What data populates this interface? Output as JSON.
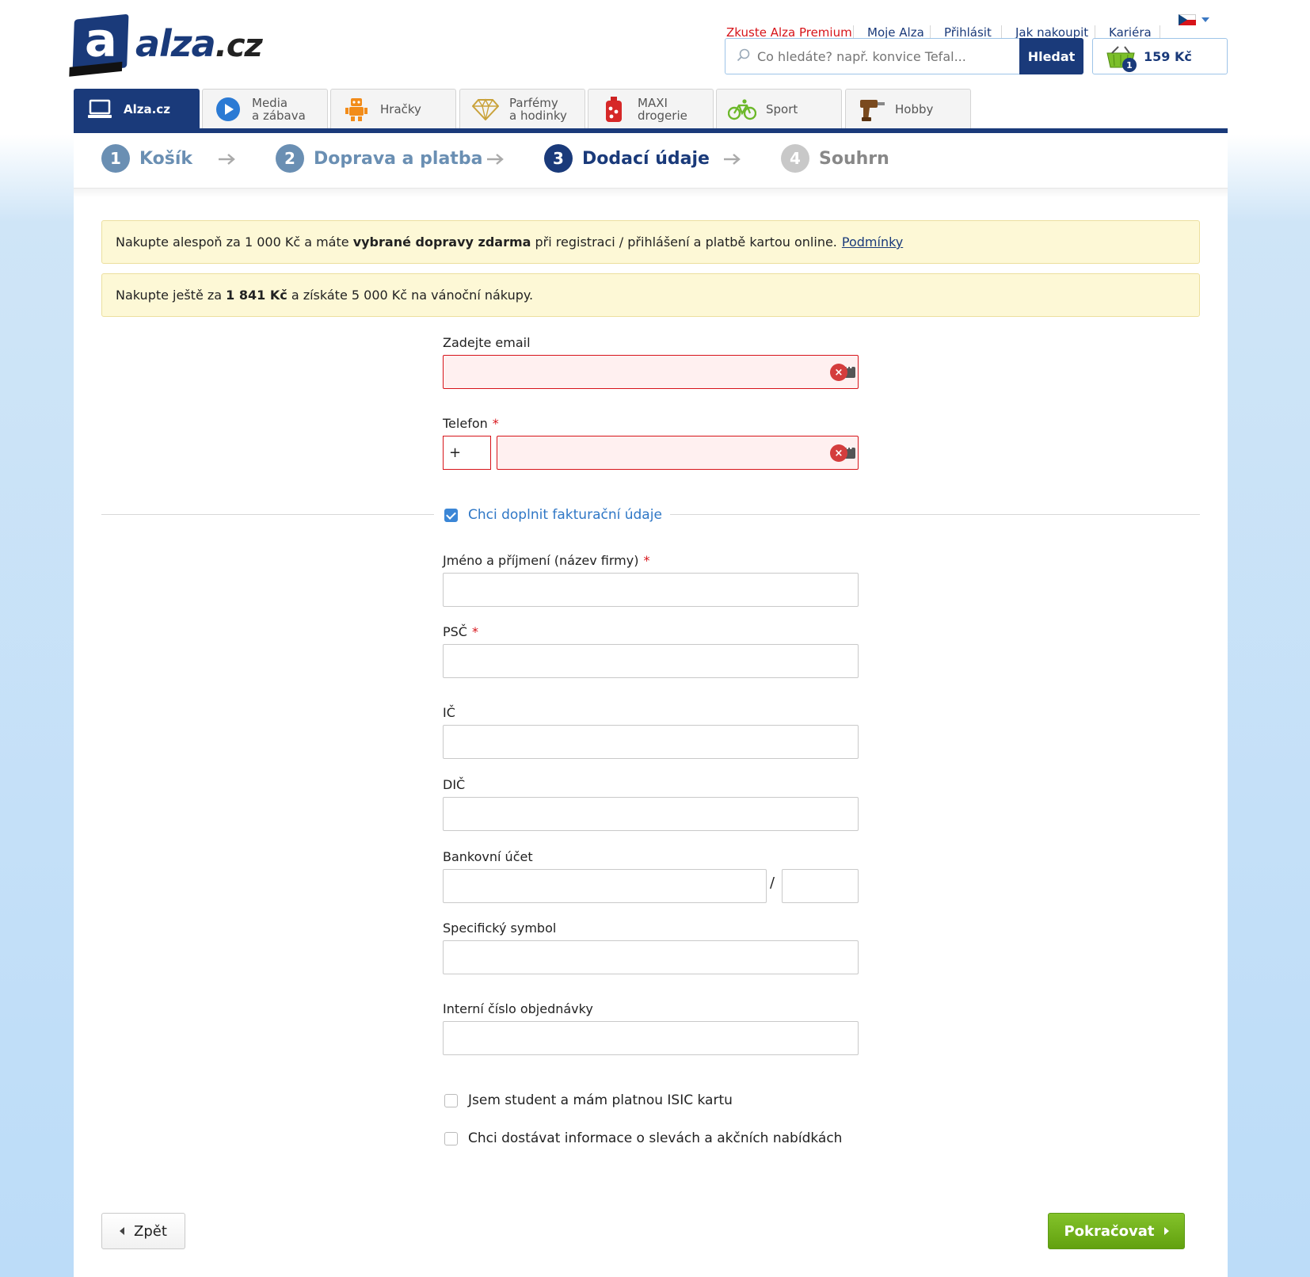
{
  "header": {
    "logo_text": "alza",
    "logo_domain": ".cz",
    "top_links": [
      {
        "label": "Zkuste Alza Premium",
        "color": "#d7141a"
      },
      {
        "label": "Moje Alza",
        "color": "#1a3a7a"
      },
      {
        "label": "Přihlásit",
        "color": "#1a3a7a"
      },
      {
        "label": "Jak nakoupit",
        "color": "#1a3a7a"
      },
      {
        "label": "Kariéra",
        "color": "#1a3a7a"
      }
    ],
    "search": {
      "placeholder": "Co hledáte? např. konvice Tefal...",
      "button": "Hledat"
    },
    "cart": {
      "count": "1",
      "price": "159 Kč"
    }
  },
  "categories": [
    {
      "label": "Alza.cz",
      "icon": "laptop-icon",
      "active": true
    },
    {
      "label_1": "Media",
      "label_2": "a zábava",
      "icon": "play-icon"
    },
    {
      "label": "Hračky",
      "icon": "robot-icon"
    },
    {
      "label_1": "Parfémy",
      "label_2": "a hodinky",
      "icon": "diamond-icon"
    },
    {
      "label_1": "MAXI",
      "label_2": "drogerie",
      "icon": "bottle-icon"
    },
    {
      "label": "Sport",
      "icon": "bicycle-icon"
    },
    {
      "label": "Hobby",
      "icon": "drill-icon"
    }
  ],
  "steps": [
    {
      "num": "1",
      "label": "Košík",
      "state": "done"
    },
    {
      "num": "2",
      "label": "Doprava a platba",
      "state": "done"
    },
    {
      "num": "3",
      "label": "Dodací údaje",
      "state": "current"
    },
    {
      "num": "4",
      "label": "Souhrn",
      "state": "todo"
    }
  ],
  "notices": {
    "n1_pre": "Nakupte alespoň za 1 000 Kč a máte ",
    "n1_bold": "vybrané dopravy zdarma",
    "n1_post": " při registraci / přihlášení a platbě kartou online.",
    "n1_link": "Podmínky",
    "n2_pre": "Nakupte ještě za ",
    "n2_bold": "1 841 Kč",
    "n2_post": " a získáte 5 000 Kč na vánoční nákupy."
  },
  "form": {
    "email_label": "Zadejte email",
    "phone_label": "Telefon",
    "phone_prefix": "+",
    "billing_checkbox": "Chci doplnit fakturační údaje",
    "billing_checked": true,
    "name_label": "Jméno a příjmení (název firmy)",
    "zip_label": "PSČ",
    "ic_label": "IČ",
    "dic_label": "DIČ",
    "bank_label": "Bankovní účet",
    "bank_separator": "/",
    "symbol_label": "Specifický symbol",
    "internal_label": "Interní číslo objednávky",
    "student_checkbox": "Jsem student a mám platnou ISIC kartu",
    "student_checked": false,
    "newsletter_checkbox": "Chci dostávat informace o slevách a akčních nabídkách",
    "newsletter_checked": false,
    "required_mark": "*",
    "clear_mark": "×"
  },
  "actions": {
    "back": "Zpět",
    "next": "Pokračovat"
  },
  "colors": {
    "brand": "#1a3a7a",
    "error": "#d7141a",
    "cta": "#6aaa14",
    "notice": "#fdf8d6"
  }
}
